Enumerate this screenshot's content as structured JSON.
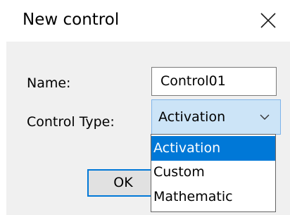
{
  "window": {
    "title": "New control",
    "close_icon": "close-icon"
  },
  "form": {
    "name_label": "Name:",
    "name_value": "Control01",
    "type_label": "Control Type:",
    "type_value": "Activation",
    "type_chevron_icon": "chevron-down-icon"
  },
  "buttons": {
    "ok_label": "OK"
  },
  "dropdown": {
    "options": [
      {
        "label": "Activation",
        "selected": true
      },
      {
        "label": "Custom",
        "selected": false
      },
      {
        "label": "Mathematic",
        "selected": false
      }
    ]
  },
  "colors": {
    "selection": "#0078d7",
    "combo_background": "#cce4f7",
    "dialog_background": "#f0f0f0"
  }
}
